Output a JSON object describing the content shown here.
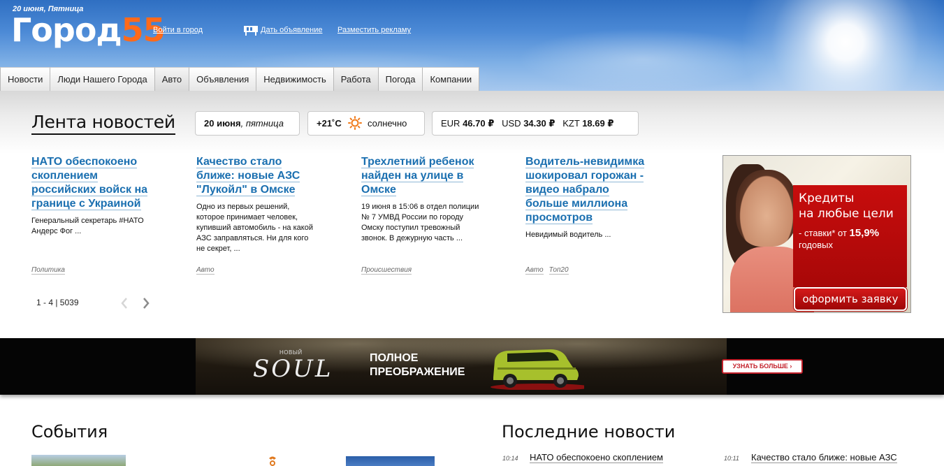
{
  "header": {
    "date": "20 июня, Пятница",
    "logo_text": "Город",
    "logo_number": "55",
    "login_link": "Войти в город",
    "post_ad_link": "Дать объявление",
    "advertise_link": "Разместить рекламу"
  },
  "nav": [
    "Новости",
    "Люди Нашего Города",
    "Авто",
    "Объявления",
    "Недвижимость",
    "Работа",
    "Погода",
    "Компании"
  ],
  "feed": {
    "title": "Лента новостей",
    "date_bold": "20 июня",
    "date_rest": ", пятница",
    "temperature": "+21˚C",
    "weather": "солнечно",
    "rates": [
      {
        "code": "EUR",
        "value": "46.70 ₽"
      },
      {
        "code": "USD",
        "value": "34.30 ₽"
      },
      {
        "code": "KZT",
        "value": "18.69 ₽"
      }
    ],
    "pager": "1 - 4 | 5039"
  },
  "news": [
    {
      "title": "НАТО обеспокоено скоплением российских войск на границе с Украиной",
      "text": "Генеральный секретарь #НАТО Андерс Фог ...",
      "tags": [
        "Политика"
      ]
    },
    {
      "title": "Качество стало ближе: новые АЗС \"Лукойл\" в Омске",
      "text": "Одно из первых решений, которое принимает человек, купивший автомобиль - на какой АЗС заправляться. Ни для кого не секрет, ...",
      "tags": [
        "Авто"
      ]
    },
    {
      "title": "Трехлетний ребенок найден на улице в Омске",
      "text": "19 июня в 15:06 в отдел полиции № 7 УМВД России по городу Омску поступил тревожный звонок. В дежурную часть ...",
      "tags": [
        "Происшествия"
      ]
    },
    {
      "title": "Водитель-невидимка шокировал горожан - видео набрало больше миллиона просмотров",
      "text": "Невидимый водитель ...",
      "tags": [
        "Авто",
        "Топ20"
      ]
    }
  ],
  "bank_ad": {
    "line1": "Кредиты",
    "line2": "на любые цели",
    "line3": "- ставки* от",
    "rate": "15,9%",
    "line4": "годовых",
    "button": "оформить заявку"
  },
  "kia_banner": {
    "new": "НОВЫЙ",
    "model": "SOUL",
    "headline1": "ПОЛНОЕ",
    "headline2": "ПРЕОБРАЖЕНИЕ",
    "button": "УЗНАТЬ БОЛЬШЕ ›"
  },
  "sections": {
    "events_title": "События",
    "latest_title": "Последние новости"
  },
  "latest_news": [
    {
      "time": "10:14",
      "title": "НАТО обеспокоено скоплением"
    },
    {
      "time": "10:11",
      "title": "Качество стало ближе: новые АЗС"
    }
  ],
  "colors": {
    "link": "#1a6fb0",
    "logo_accent": "#ff6a1a",
    "bank_red": "#c70d0d"
  }
}
